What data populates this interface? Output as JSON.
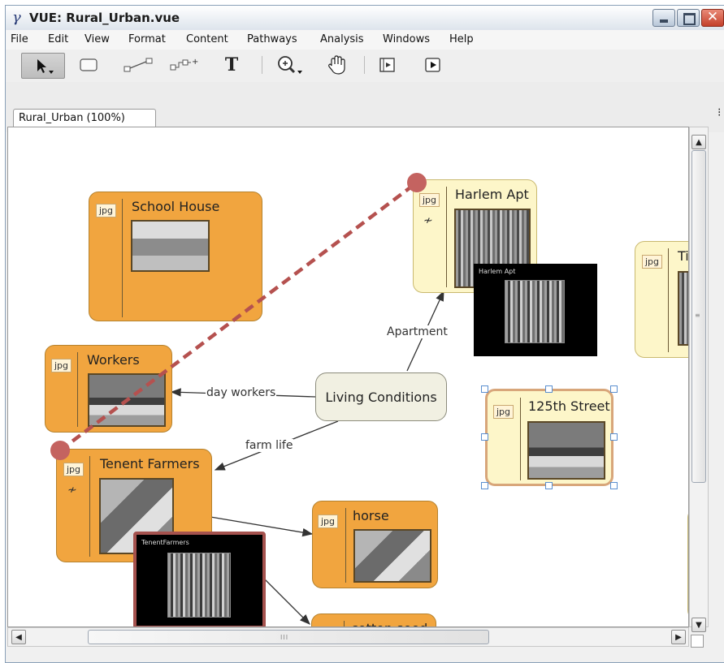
{
  "window": {
    "title": "VUE: Rural_Urban.vue",
    "app_icon": "vue-logo-icon"
  },
  "window_controls": {
    "minimize": "minimize-icon",
    "maximize": "maximize-icon",
    "close": "close-icon"
  },
  "menu": [
    "File",
    "Edit",
    "View",
    "Format",
    "Content",
    "Pathways",
    "Analysis",
    "Windows",
    "Help"
  ],
  "toolbar": {
    "tools": [
      "selection-arrow-icon",
      "node-tool-icon",
      "link-tool-icon",
      "curved-link-tool-icon",
      "text-tool-icon",
      "zoom-tool-icon",
      "pan-hand-icon",
      "presentation-icon",
      "play-icon"
    ],
    "text_tool_glyph": "T"
  },
  "tab": {
    "label": "Rural_Urban (100%)"
  },
  "map": {
    "center_node": "Living Conditions",
    "nodes": [
      {
        "title": "School House",
        "badge": "jpg"
      },
      {
        "title": "Harlem Apt",
        "badge": "jpg"
      },
      {
        "title": "Workers",
        "badge": "jpg"
      },
      {
        "title": "Tenent Farmers",
        "badge": "jpg"
      },
      {
        "title": "125th Street",
        "badge": "jpg"
      },
      {
        "title": "horse",
        "badge": "jpg"
      },
      {
        "title": "cotton seed",
        "badge": "jpg"
      },
      {
        "title": "Tir",
        "badge": "jpg"
      }
    ],
    "link_labels": [
      "Apartment",
      "day workers",
      "farm life"
    ],
    "popups": [
      {
        "label": "Harlem Apt"
      },
      {
        "label": "TenentFarmers"
      }
    ],
    "colors": {
      "node_orange": "#f1a53f",
      "node_yellow": "#fdf6c9",
      "pathway_red": "#b5514f",
      "selection_blue": "#5b8fcf"
    }
  },
  "scrollbar": {
    "grip": "III"
  }
}
